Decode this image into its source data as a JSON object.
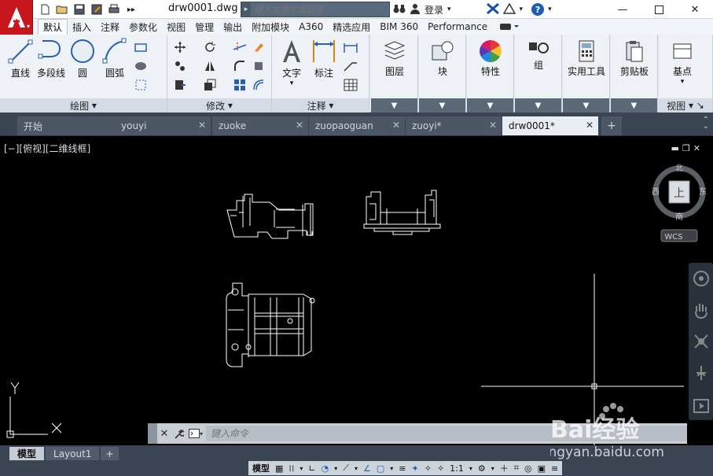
{
  "title_bar": {
    "document_title": "drw0001.dwg",
    "search_placeholder": "键入关键字或短语",
    "login_label": "登录",
    "help_label": "?"
  },
  "ribbon_tabs": [
    "默认",
    "插入",
    "注释",
    "参数化",
    "视图",
    "管理",
    "输出",
    "附加模块",
    "A360",
    "精选应用",
    "BIM 360",
    "Performance"
  ],
  "active_ribbon_tab": "默认",
  "draw_panel": {
    "title": "绘图",
    "buttons": [
      "直线",
      "多段线",
      "圆",
      "圆弧"
    ]
  },
  "modify_panel": {
    "title": "修改"
  },
  "annotation_panel": {
    "title": "注释",
    "buttons": [
      "文字",
      "标注"
    ]
  },
  "layers_panel": {
    "label": "图层"
  },
  "block_panel": {
    "label": "块"
  },
  "properties_panel": {
    "label": "特性"
  },
  "group_panel": {
    "label": "组"
  },
  "utilities_panel": {
    "label": "实用工具"
  },
  "clipboard_panel": {
    "label": "剪贴板"
  },
  "view_panel": {
    "label": "基点",
    "title": "视图"
  },
  "file_tabs": [
    "开始",
    "youyi",
    "zuoke",
    "zuopaoguan",
    "zuoyi*",
    "drw0001*"
  ],
  "active_file_tab": "drw0001*",
  "viewport": {
    "label": "[−][俯视][二维线框]",
    "viewcube": {
      "north": "北",
      "south": "南",
      "east": "东",
      "west": "西",
      "top_face": "上",
      "wcs": "WCS"
    },
    "ucs_y": "Y",
    "ucs_x": "X"
  },
  "command_line": {
    "placeholder": "键入命令"
  },
  "layout_tabs": [
    "模型",
    "Layout1"
  ],
  "active_layout_tab": "模型",
  "status_bar": {
    "model_label": "模型",
    "scale": "1:1"
  },
  "watermark": {
    "text": "Bai经验",
    "url": "jingyan.baidu.com"
  },
  "colors": {
    "brand_red": "#c8161d",
    "ribbon_bg": "#eef2f6",
    "tab_bar": "#3b4453"
  }
}
